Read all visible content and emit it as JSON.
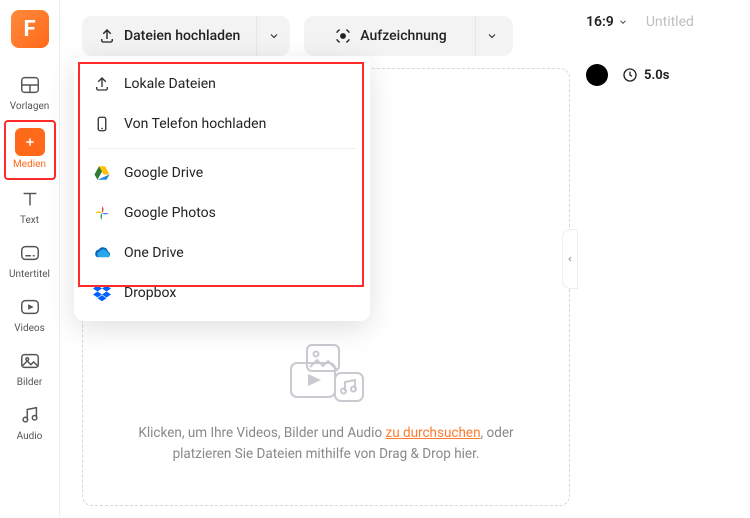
{
  "sidebar": {
    "items": [
      {
        "label": "Vorlagen"
      },
      {
        "label": "Medien"
      },
      {
        "label": "Text"
      },
      {
        "label": "Untertitel"
      },
      {
        "label": "Videos"
      },
      {
        "label": "Bilder"
      },
      {
        "label": "Audio"
      }
    ]
  },
  "toolbar": {
    "upload_label": "Dateien hochladen",
    "record_label": "Aufzeichnung"
  },
  "upload_menu": {
    "local": "Lokale Dateien",
    "phone": "Von Telefon hochladen",
    "gdrive": "Google Drive",
    "gphotos": "Google Photos",
    "onedrive": "One Drive",
    "dropbox": "Dropbox"
  },
  "dropzone": {
    "line1_a": "Klicken, um Ihre Videos, Bilder und Audio ",
    "line1_link": "zu durchsuchen",
    "line2": ", oder platzieren Sie Dateien mithilfe von Drag & Drop hier."
  },
  "right": {
    "ratio": "16:9",
    "title": "Untitled",
    "duration": "5.0s"
  }
}
